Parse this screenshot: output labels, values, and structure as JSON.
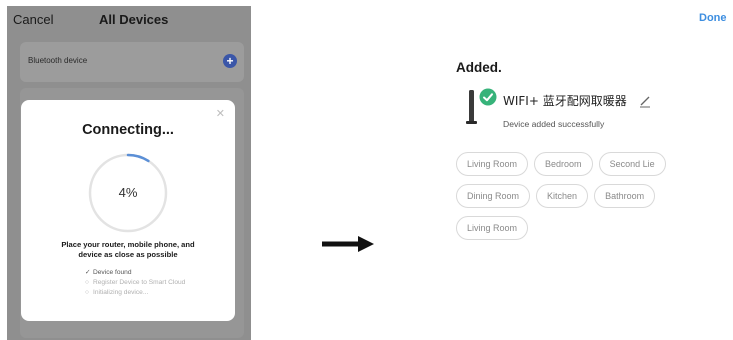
{
  "left_screen": {
    "cancel_label": "Cancel",
    "title": "All Devices",
    "bluetooth_label": "Bluetooth device",
    "dialog": {
      "title": "Connecting...",
      "progress_text": "4%",
      "progress_fraction": 0.04,
      "instruction_line1": "Place your router, mobile phone, and",
      "instruction_line2": "device as close as possible",
      "steps": [
        {
          "label": "Device found",
          "status": "done"
        },
        {
          "label": "Register Device to Smart Cloud",
          "status": "pending"
        },
        {
          "label": "Initializing device...",
          "status": "pending"
        }
      ]
    }
  },
  "right_screen": {
    "done_label": "Done",
    "added_title": "Added.",
    "device_name": "WIFI+ 蓝牙配网取暖器",
    "device_status": "Device added successfully",
    "rooms": [
      [
        "Living Room",
        "Bedroom",
        "Second Lie"
      ],
      [
        "Dining Room",
        "Kitchen",
        "Bathroom"
      ],
      [
        "Living Room"
      ]
    ]
  },
  "colors": {
    "accent_blue": "#3d8ee0",
    "progress_blue": "#5b8fd6",
    "check_green": "#37b37a",
    "overlay_gray": "#8f8f8f"
  }
}
